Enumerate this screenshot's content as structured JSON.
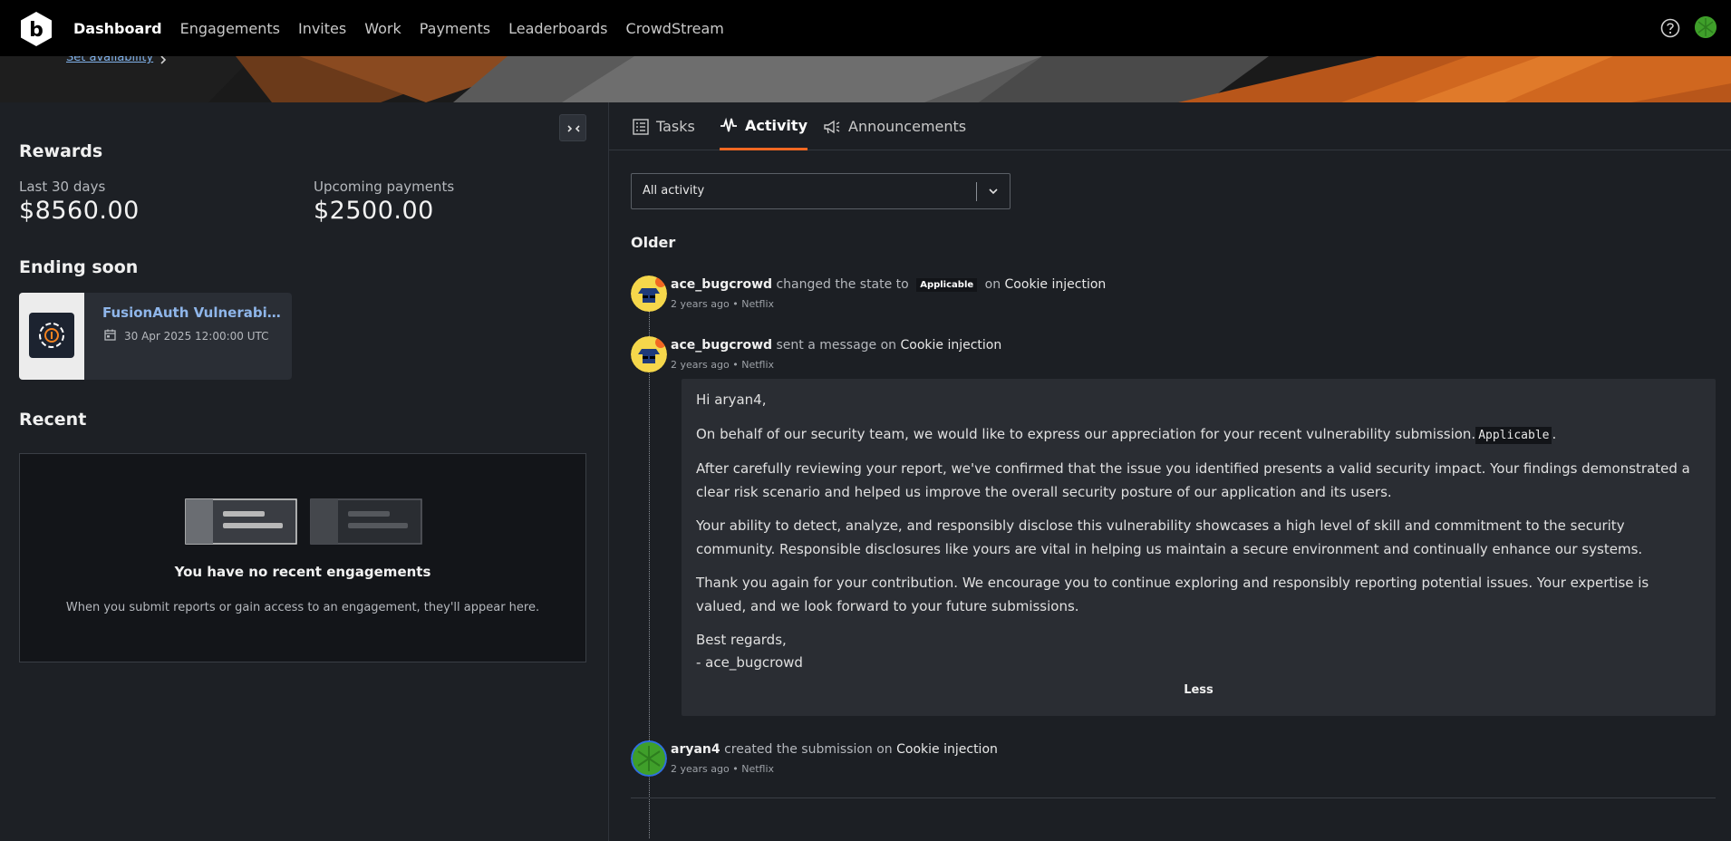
{
  "nav": {
    "items": [
      "Dashboard",
      "Engagements",
      "Invites",
      "Work",
      "Payments",
      "Leaderboards",
      "CrowdStream"
    ],
    "active": "Dashboard"
  },
  "hero": {
    "link_text": "Set availability"
  },
  "rewards": {
    "heading": "Rewards",
    "last30_label": "Last 30 days",
    "last30_value": "$8560.00",
    "upcoming_label": "Upcoming payments",
    "upcoming_value": "$2500.00"
  },
  "ending_soon": {
    "heading": "Ending soon",
    "card": {
      "title": "FusionAuth Vulnerabili…",
      "date": "30 Apr 2025 12:00:00 UTC"
    }
  },
  "recent": {
    "heading": "Recent",
    "empty_title": "You have no recent engagements",
    "empty_desc": "When you submit reports or gain access to an engagement, they'll appear here."
  },
  "tabs": [
    {
      "label": "Tasks",
      "icon": "list-icon"
    },
    {
      "label": "Activity",
      "icon": "activity-icon"
    },
    {
      "label": "Announcements",
      "icon": "megaphone-icon"
    }
  ],
  "active_tab": "Activity",
  "filter": {
    "selected": "All activity"
  },
  "feed": {
    "group_label": "Older",
    "items": [
      {
        "user": "ace_bugcrowd",
        "action": "changed the state to",
        "badge": "Applicable",
        "on_word": "on",
        "target": "Cookie injection",
        "time": "2 years ago",
        "program": "Netflix"
      },
      {
        "user": "ace_bugcrowd",
        "action": "sent a message on",
        "target": "Cookie injection",
        "time": "2 years ago",
        "program": "Netflix"
      },
      {
        "user": "aryan4",
        "action": "created the submission on",
        "target": "Cookie injection",
        "time": "2 years ago",
        "program": "Netflix"
      }
    ],
    "separator": "•"
  },
  "message": {
    "greeting": "Hi aryan4,",
    "p1": "On behalf of our security team, we would like to express our appreciation for your recent vulnerability submission.",
    "p1_code": "Applicable",
    "p1_end": ".",
    "p2": "After carefully reviewing your report, we've confirmed that the issue you identified presents a valid security impact. Your findings demonstrated a clear risk scenario and helped us improve the overall security posture of our application and its users.",
    "p3": "Your ability to detect, analyze, and responsibly disclose this vulnerability showcases a high level of skill and commitment to the security community. Responsible disclosures like yours are vital in helping us maintain a secure environment and continually enhance our systems.",
    "p4": "Thank you again for your contribution. We encourage you to continue exploring and responsibly reporting potential issues. Your expertise is valued, and we look forward to your future submissions.",
    "sign1": "Best regards,",
    "sign2": "- ace_bugcrowd",
    "less_label": "Less"
  },
  "colors": {
    "accent": "#f26822",
    "link": "#8fb6ea",
    "badge_bg": "#121418"
  }
}
